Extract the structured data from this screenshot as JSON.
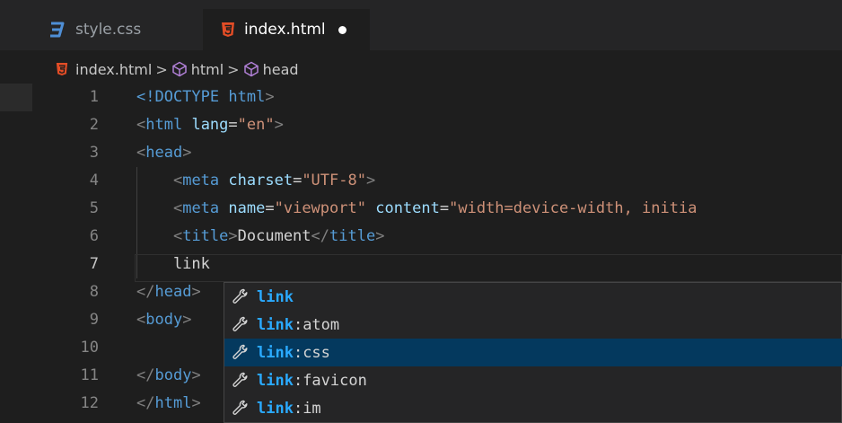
{
  "tabs": [
    {
      "label": "style.css",
      "icon": "css-icon",
      "active": false
    },
    {
      "label": "index.html",
      "icon": "html5-icon",
      "active": true,
      "unsaved": true
    }
  ],
  "breadcrumb": {
    "file": "index.html",
    "items": [
      "html",
      "head"
    ],
    "separator": ">"
  },
  "editor": {
    "current_line": 7,
    "lines": [
      {
        "n": "1",
        "tokens": [
          {
            "t": "<!DOCTYPE",
            "c": "t-tag"
          },
          {
            "t": " ",
            "c": "t-txt"
          },
          {
            "t": "html",
            "c": "t-tag"
          },
          {
            "t": ">",
            "c": "t-br"
          }
        ]
      },
      {
        "n": "2",
        "tokens": [
          {
            "t": "<",
            "c": "t-br"
          },
          {
            "t": "html",
            "c": "t-tag"
          },
          {
            "t": " ",
            "c": "t-txt"
          },
          {
            "t": "lang",
            "c": "t-attr"
          },
          {
            "t": "=",
            "c": "t-txt"
          },
          {
            "t": "\"en\"",
            "c": "t-str"
          },
          {
            "t": ">",
            "c": "t-br"
          }
        ]
      },
      {
        "n": "3",
        "tokens": [
          {
            "t": "<",
            "c": "t-br"
          },
          {
            "t": "head",
            "c": "t-tag"
          },
          {
            "t": ">",
            "c": "t-br"
          }
        ]
      },
      {
        "n": "4",
        "tokens": [
          {
            "t": "    ",
            "c": "t-txt"
          },
          {
            "t": "<",
            "c": "t-br"
          },
          {
            "t": "meta",
            "c": "t-tag"
          },
          {
            "t": " ",
            "c": "t-txt"
          },
          {
            "t": "charset",
            "c": "t-attr"
          },
          {
            "t": "=",
            "c": "t-txt"
          },
          {
            "t": "\"UTF-8\"",
            "c": "t-str"
          },
          {
            "t": ">",
            "c": "t-br"
          }
        ]
      },
      {
        "n": "5",
        "tokens": [
          {
            "t": "    ",
            "c": "t-txt"
          },
          {
            "t": "<",
            "c": "t-br"
          },
          {
            "t": "meta",
            "c": "t-tag"
          },
          {
            "t": " ",
            "c": "t-txt"
          },
          {
            "t": "name",
            "c": "t-attr"
          },
          {
            "t": "=",
            "c": "t-txt"
          },
          {
            "t": "\"viewport\"",
            "c": "t-str"
          },
          {
            "t": " ",
            "c": "t-txt"
          },
          {
            "t": "content",
            "c": "t-attr"
          },
          {
            "t": "=",
            "c": "t-txt"
          },
          {
            "t": "\"width=device-width, initia",
            "c": "t-str"
          }
        ]
      },
      {
        "n": "6",
        "tokens": [
          {
            "t": "    ",
            "c": "t-txt"
          },
          {
            "t": "<",
            "c": "t-br"
          },
          {
            "t": "title",
            "c": "t-tag"
          },
          {
            "t": ">",
            "c": "t-br"
          },
          {
            "t": "Document",
            "c": "t-txt"
          },
          {
            "t": "</",
            "c": "t-br"
          },
          {
            "t": "title",
            "c": "t-tag"
          },
          {
            "t": ">",
            "c": "t-br"
          }
        ]
      },
      {
        "n": "7",
        "tokens": [
          {
            "t": "    link",
            "c": "t-txt"
          }
        ]
      },
      {
        "n": "8",
        "tokens": [
          {
            "t": "</",
            "c": "t-br"
          },
          {
            "t": "head",
            "c": "t-tag"
          },
          {
            "t": ">",
            "c": "t-br"
          }
        ]
      },
      {
        "n": "9",
        "tokens": [
          {
            "t": "<",
            "c": "t-br"
          },
          {
            "t": "body",
            "c": "t-tag"
          },
          {
            "t": ">",
            "c": "t-br"
          }
        ]
      },
      {
        "n": "10",
        "tokens": []
      },
      {
        "n": "11",
        "tokens": [
          {
            "t": "</",
            "c": "t-br"
          },
          {
            "t": "body",
            "c": "t-tag"
          },
          {
            "t": ">",
            "c": "t-br"
          }
        ]
      },
      {
        "n": "12",
        "tokens": [
          {
            "t": "</",
            "c": "t-br"
          },
          {
            "t": "html",
            "c": "t-tag"
          },
          {
            "t": ">",
            "c": "t-br"
          }
        ]
      }
    ]
  },
  "suggestions": {
    "selected_index": 2,
    "icon": "wrench-icon",
    "items": [
      {
        "match": "link",
        "rest": ""
      },
      {
        "match": "link",
        "rest": ":atom"
      },
      {
        "match": "link",
        "rest": ":css"
      },
      {
        "match": "link",
        "rest": ":favicon"
      },
      {
        "match": "link",
        "rest": ":im"
      }
    ]
  },
  "colors": {
    "background": "#1e1e1e",
    "tag": "#569cd6",
    "attribute": "#9cdcfe",
    "string": "#ce9178",
    "match": "#2aaaff",
    "selection": "#04395e"
  }
}
